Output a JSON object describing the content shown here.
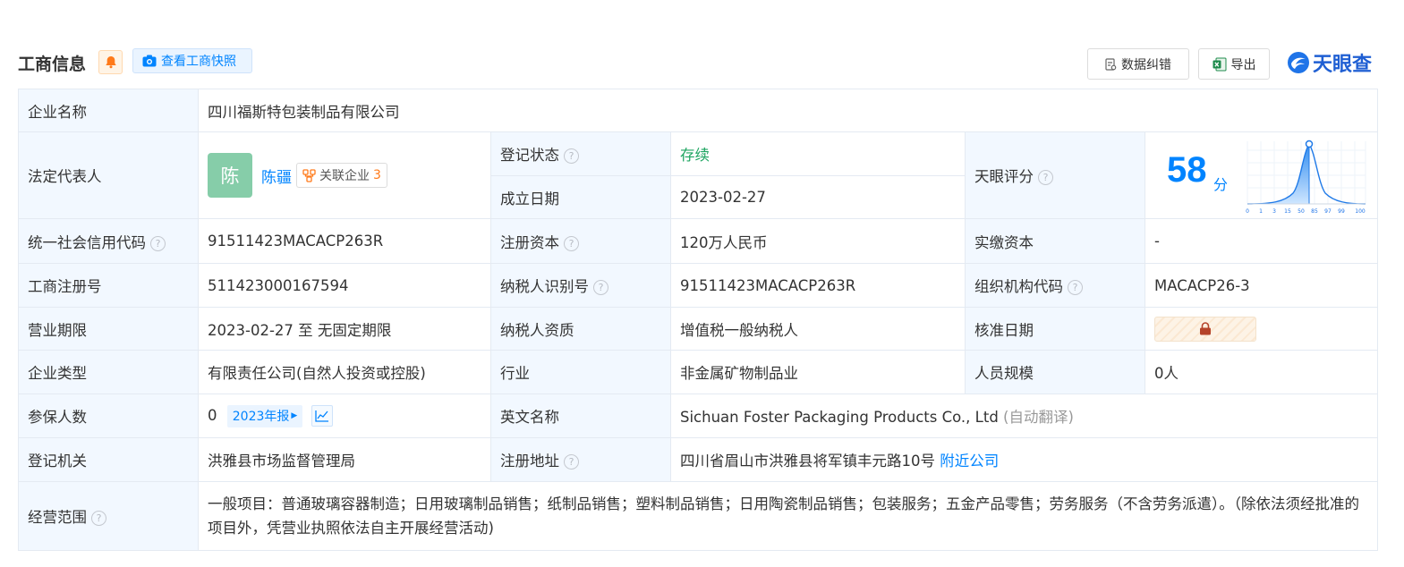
{
  "header": {
    "title": "工商信息",
    "snapshot_label": "查看工商快照",
    "correct_label": "数据纠错",
    "export_label": "导出",
    "logo_text": "天眼查"
  },
  "company": {
    "name_label": "企业名称",
    "name_value": "四川福斯特包装制品有限公司"
  },
  "legal": {
    "label": "法定代表人",
    "avatar_char": "陈",
    "name": "陈疆",
    "related_label": "关联企业",
    "related_count": "3"
  },
  "status": {
    "label": "登记状态",
    "value": "存续"
  },
  "founded": {
    "label": "成立日期",
    "value": "2023-02-27"
  },
  "score": {
    "label": "天眼评分",
    "value": "58",
    "unit": "分",
    "axis_ticks": [
      "0",
      "1",
      "3",
      "15",
      "50",
      "85",
      "97",
      "99",
      "100"
    ]
  },
  "credit_code": {
    "label": "统一社会信用代码",
    "value": "91511423MACACP263R"
  },
  "reg_capital": {
    "label": "注册资本",
    "value": "120万人民币"
  },
  "paid_capital": {
    "label": "实缴资本",
    "value": "-"
  },
  "reg_no": {
    "label": "工商注册号",
    "value": "511423000167594"
  },
  "taxpayer_id": {
    "label": "纳税人识别号",
    "value": "91511423MACACP263R"
  },
  "org_code": {
    "label": "组织机构代码",
    "value": "MACACP26-3"
  },
  "term": {
    "label": "营业期限",
    "value": "2023-02-27 至 无固定期限"
  },
  "taxpayer_type": {
    "label": "纳税人资质",
    "value": "增值税一般纳税人"
  },
  "approval_date": {
    "label": "核准日期"
  },
  "company_type": {
    "label": "企业类型",
    "value": "有限责任公司(自然人投资或控股)"
  },
  "industry": {
    "label": "行业",
    "value": "非金属矿物制品业"
  },
  "staff_size": {
    "label": "人员规模",
    "value": "0人"
  },
  "insured": {
    "label": "参保人数",
    "value": "0",
    "report_label": "2023年报"
  },
  "english_name": {
    "label": "英文名称",
    "value": "Sichuan Foster Packaging Products Co., Ltd",
    "note": "(自动翻译)"
  },
  "authority": {
    "label": "登记机关",
    "value": "洪雅县市场监督管理局"
  },
  "address": {
    "label": "注册地址",
    "value": "四川省眉山市洪雅县将军镇丰元路10号",
    "link": "附近公司"
  },
  "scope": {
    "label": "经营范围",
    "value": "一般项目：普通玻璃容器制造；日用玻璃制品销售；纸制品销售；塑料制品销售；日用陶瓷制品销售；包装服务；五金产品零售；劳务服务（不含劳务派遣）。（除依法须经批准的项目外，凭营业执照依法自主开展经营活动)"
  },
  "colors": {
    "accent": "#0084ff",
    "status_green": "#1ea561",
    "label_bg": "#f2f8ff",
    "avatar_bg": "#86cda9"
  }
}
